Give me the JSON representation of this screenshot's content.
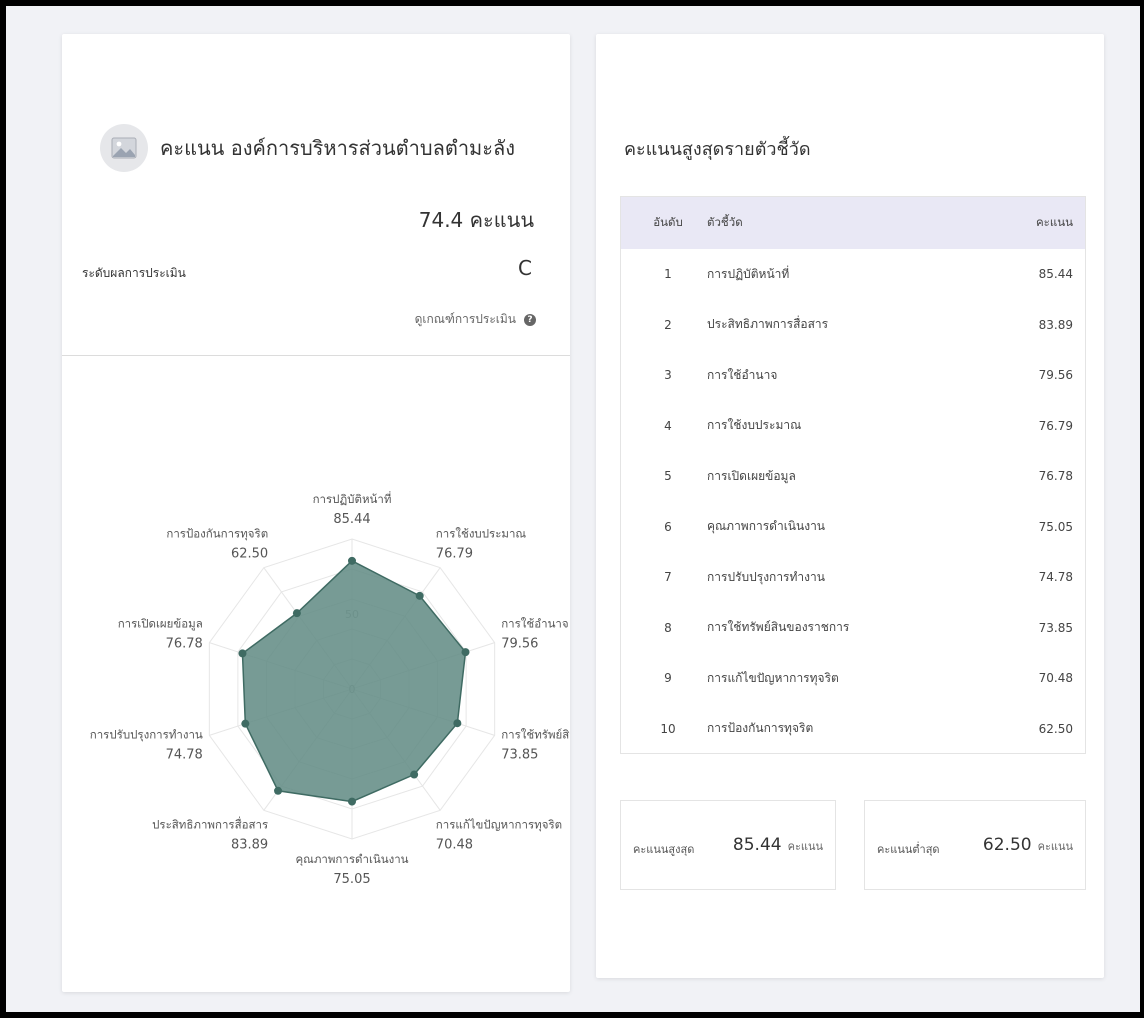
{
  "left": {
    "org_title": "คะแนน องค์การบริหารส่วนตำบลตำมะลัง",
    "score_text": "74.4 คะแนน",
    "level_label": "ระดับผลการประเมิน",
    "level_value": "C",
    "criteria_link": "ดูเกณฑ์การประเมิน",
    "help_icon": "?"
  },
  "chart_data": {
    "type": "radar",
    "range": [
      0,
      100
    ],
    "ticks": [
      "0",
      "50"
    ],
    "color": "#5f8a82",
    "axes": [
      {
        "label": "การปฏิบัติหน้าที่",
        "value": 85.44,
        "value_text": "85.44"
      },
      {
        "label": "การใช้งบประมาณ",
        "value": 76.79,
        "value_text": "76.79"
      },
      {
        "label": "การใช้อำนาจ",
        "value": 79.56,
        "value_text": "79.56"
      },
      {
        "label": "การใช้ทรัพย์สิน",
        "value": 73.85,
        "value_text": "73.85"
      },
      {
        "label": "การแก้ไขปัญหาการทุจริต",
        "value": 70.48,
        "value_text": "70.48"
      },
      {
        "label": "คุณภาพการดำเนินงาน",
        "value": 75.05,
        "value_text": "75.05"
      },
      {
        "label": "ประสิทธิภาพการสื่อสาร",
        "value": 83.89,
        "value_text": "83.89"
      },
      {
        "label": "การปรับปรุงการทำงาน",
        "value": 74.78,
        "value_text": "74.78"
      },
      {
        "label": "การเปิดเผยข้อมูล",
        "value": 76.78,
        "value_text": "76.78"
      },
      {
        "label": "การป้องกันการทุจริต",
        "value": 62.5,
        "value_text": "62.50"
      }
    ]
  },
  "right": {
    "title": "คะแนนสูงสุดรายตัวชี้วัด",
    "table": {
      "headers": [
        "อันดับ",
        "ตัวชี้วัด",
        "คะแนน"
      ],
      "rows": [
        {
          "rank": "1",
          "name": "การปฏิบัติหน้าที่",
          "score": "85.44"
        },
        {
          "rank": "2",
          "name": "ประสิทธิภาพการสื่อสาร",
          "score": "83.89"
        },
        {
          "rank": "3",
          "name": "การใช้อำนาจ",
          "score": "79.56"
        },
        {
          "rank": "4",
          "name": "การใช้งบประมาณ",
          "score": "76.79"
        },
        {
          "rank": "5",
          "name": "การเปิดเผยข้อมูล",
          "score": "76.78"
        },
        {
          "rank": "6",
          "name": "คุณภาพการดำเนินงาน",
          "score": "75.05"
        },
        {
          "rank": "7",
          "name": "การปรับปรุงการทำงาน",
          "score": "74.78"
        },
        {
          "rank": "8",
          "name": "การใช้ทรัพย์สินของราชการ",
          "score": "73.85"
        },
        {
          "rank": "9",
          "name": "การแก้ไขปัญหาการทุจริต",
          "score": "70.48"
        },
        {
          "rank": "10",
          "name": "การป้องกันการทุจริต",
          "score": "62.50"
        }
      ]
    },
    "max": {
      "label": "คะแนนสูงสุด",
      "value": "85.44",
      "unit": "คะแนน"
    },
    "min": {
      "label": "คะแนนต่ำสุด",
      "value": "62.50",
      "unit": "คะแนน"
    }
  }
}
